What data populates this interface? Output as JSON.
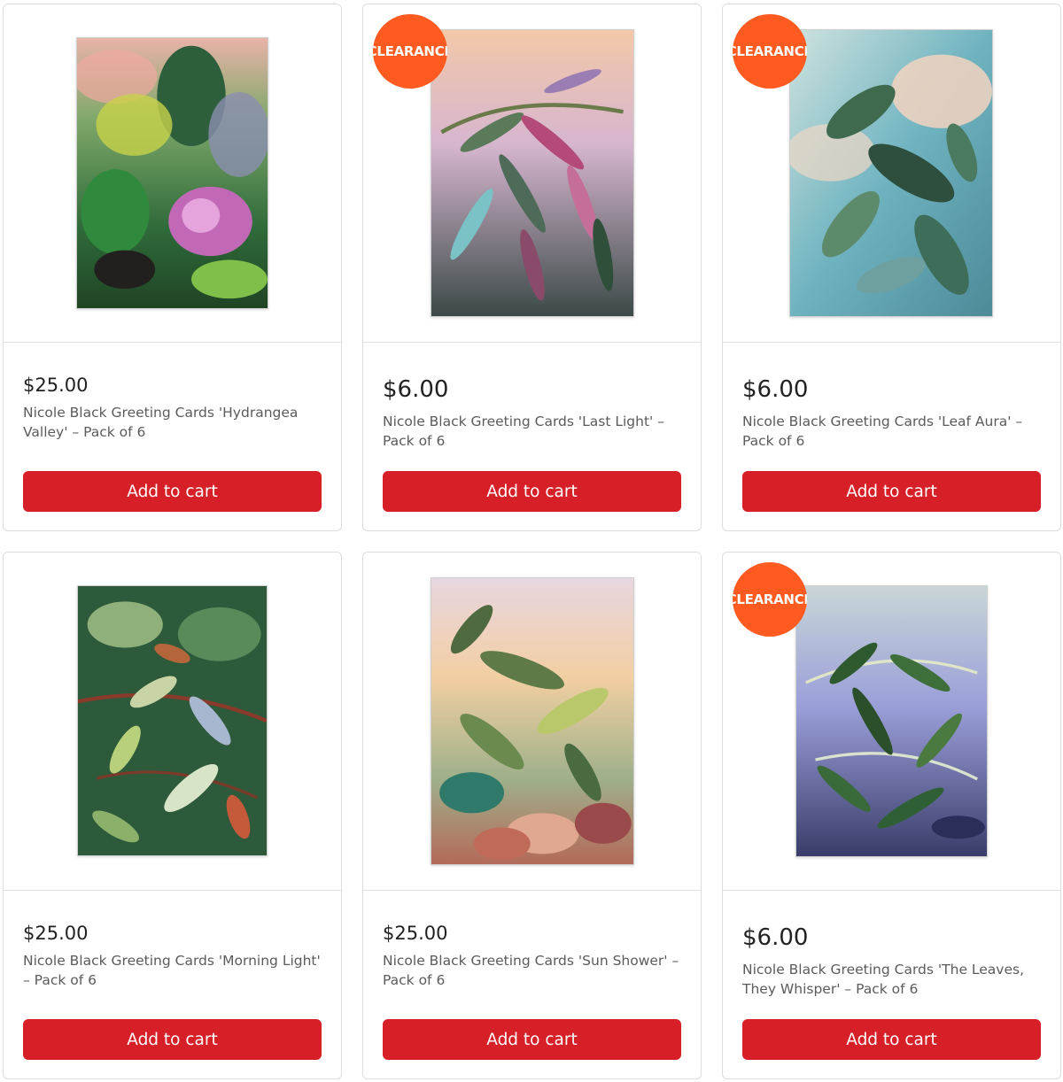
{
  "badge_text": "CLEARANCE",
  "colors": {
    "cta": "#d61f26",
    "badge": "#ff5a1f",
    "price": "#222222",
    "title": "#5b5b5b"
  },
  "products": [
    {
      "price": "$25.00",
      "title": "Nicole Black Greeting Cards 'Hydrangea Valley' – Pack of 6",
      "cta": "Add to cart",
      "clearance": false
    },
    {
      "price": "$6.00",
      "title": "Nicole Black Greeting Cards 'Last Light' – Pack of 6",
      "cta": "Add to cart",
      "clearance": true
    },
    {
      "price": "$6.00",
      "title": "Nicole Black Greeting Cards 'Leaf Aura' – Pack of 6",
      "cta": "Add to cart",
      "clearance": true
    },
    {
      "price": "$25.00",
      "title": "Nicole Black Greeting Cards 'Morning Light' – Pack of 6",
      "cta": "Add to cart",
      "clearance": false
    },
    {
      "price": "$25.00",
      "title": "Nicole Black Greeting Cards 'Sun Shower' – Pack of 6",
      "cta": "Add to cart",
      "clearance": false
    },
    {
      "price": "$6.00",
      "title": "Nicole Black Greeting Cards 'The Leaves, They Whisper' – Pack of 6",
      "cta": "Add to cart",
      "clearance": true
    }
  ]
}
